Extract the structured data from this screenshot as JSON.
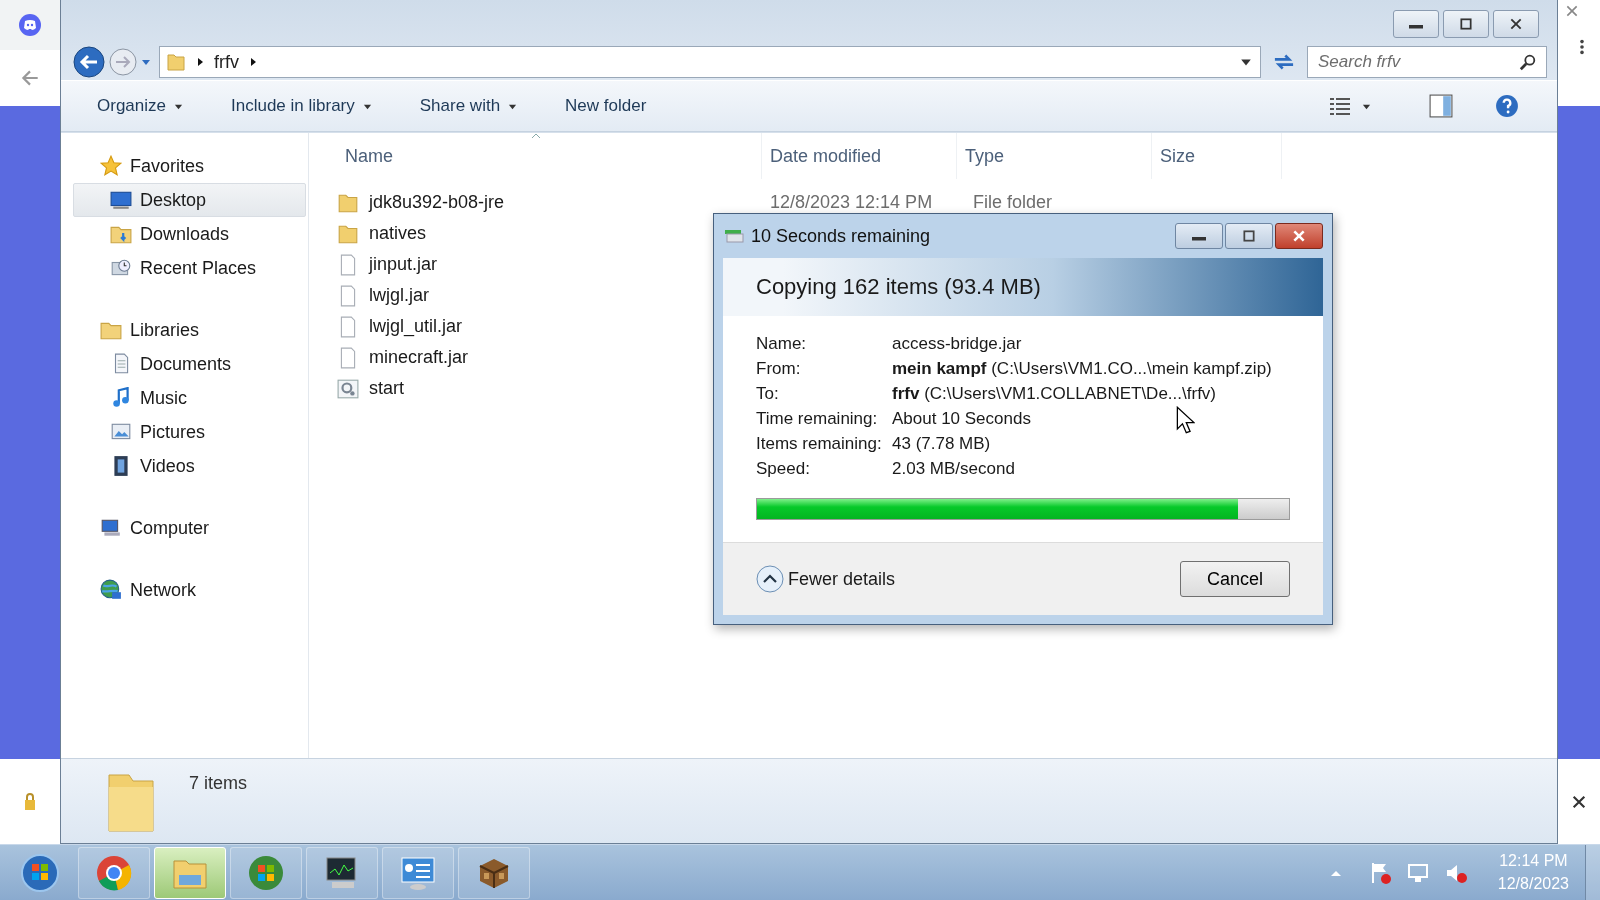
{
  "address": {
    "crumbs": [
      "frfv"
    ]
  },
  "search": {
    "placeholder": "Search frfv"
  },
  "toolbar": [
    {
      "label": "Organize",
      "dropdown": true
    },
    {
      "label": "Include in library",
      "dropdown": true
    },
    {
      "label": "Share with",
      "dropdown": true
    },
    {
      "label": "New folder",
      "dropdown": false
    }
  ],
  "nav": [
    {
      "label": "Favorites",
      "kind": "favorites",
      "selected": false,
      "children": [
        {
          "label": "Desktop",
          "kind": "desktop",
          "selected": true
        },
        {
          "label": "Downloads",
          "kind": "downloads",
          "selected": false
        },
        {
          "label": "Recent Places",
          "kind": "recent",
          "selected": false
        }
      ]
    },
    {
      "label": "Libraries",
      "kind": "libraries",
      "selected": false,
      "children": [
        {
          "label": "Documents",
          "kind": "documents",
          "selected": false
        },
        {
          "label": "Music",
          "kind": "music",
          "selected": false
        },
        {
          "label": "Pictures",
          "kind": "pictures",
          "selected": false
        },
        {
          "label": "Videos",
          "kind": "videos",
          "selected": false
        }
      ]
    },
    {
      "label": "Computer",
      "kind": "computer",
      "selected": false
    },
    {
      "label": "Network",
      "kind": "network",
      "selected": false
    }
  ],
  "columns": [
    "Name",
    "Date modified",
    "Type",
    "Size"
  ],
  "files": [
    {
      "name": "jdk8u392-b08-jre",
      "kind": "folder",
      "date": "12/8/2023 12:14 PM",
      "type": "File folder"
    },
    {
      "name": "natives",
      "kind": "folder"
    },
    {
      "name": "jinput.jar",
      "kind": "file"
    },
    {
      "name": "lwjgl.jar",
      "kind": "file"
    },
    {
      "name": "lwjgl_util.jar",
      "kind": "file"
    },
    {
      "name": "minecraft.jar",
      "kind": "file"
    },
    {
      "name": "start",
      "kind": "script"
    }
  ],
  "details": {
    "count": "7 items"
  },
  "dialog": {
    "title": "10 Seconds remaining",
    "heading": "Copying 162 items (93.4 MB)",
    "fields": [
      {
        "label": "Name:",
        "value": "access-bridge.jar"
      },
      {
        "label": "From:",
        "value": "**mein kampf** (C:\\Users\\VM1.CO...\\mein kampf.zip)"
      },
      {
        "label": "To:",
        "value": "**frfv** (C:\\Users\\VM1.COLLABNET\\De...\\frfv)"
      },
      {
        "label": "Time remaining:",
        "value": "About 10 Seconds"
      },
      {
        "label": "Items remaining:",
        "value": "43 (7.78 MB)"
      },
      {
        "label": "Speed:",
        "value": "2.03 MB/second"
      }
    ],
    "level": 0.905,
    "toggle": "Fewer details",
    "cancel": "Cancel"
  },
  "taskbar": [
    {
      "kind": "start",
      "selected": false
    },
    {
      "kind": "chrome",
      "selected": false
    },
    {
      "kind": "explorer",
      "selected": true
    },
    {
      "kind": "windows",
      "selected": false
    },
    {
      "kind": "monitor",
      "selected": false
    },
    {
      "kind": "panel",
      "selected": false
    },
    {
      "kind": "crate",
      "selected": false
    }
  ],
  "tray": {
    "time": "12:14 PM",
    "date": "12/8/2023"
  }
}
